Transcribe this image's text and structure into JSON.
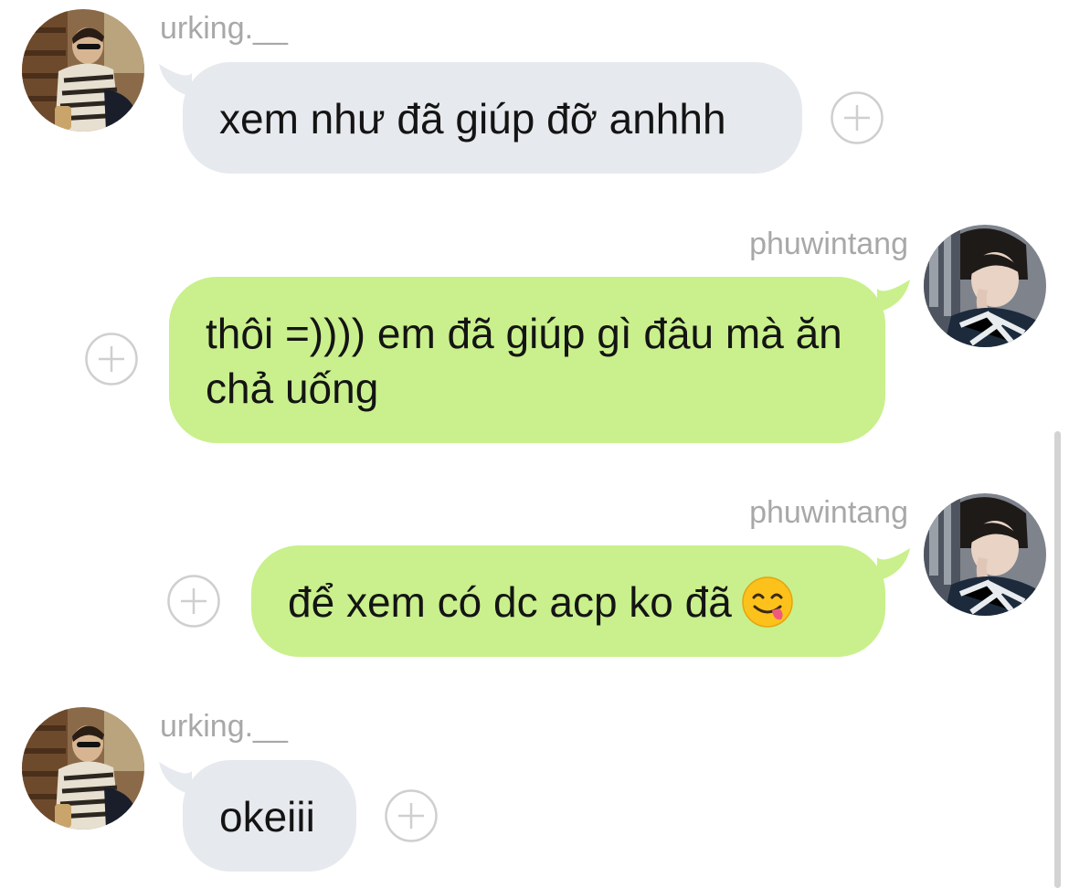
{
  "messages": [
    {
      "sender": "urking.__",
      "direction": "incoming",
      "text": "xem như đã giúp đỡ anhhh"
    },
    {
      "sender": "phuwintang",
      "direction": "outgoing",
      "text": "thôi =)))) em đã giúp gì đâu mà ăn chả uống"
    },
    {
      "sender": "phuwintang",
      "direction": "outgoing",
      "text": "để xem có dc acp ko đã",
      "emoji": "face-savoring-food"
    },
    {
      "sender": "urking.__",
      "direction": "incoming",
      "text": "okeiii"
    }
  ],
  "colors": {
    "incoming_bubble": "#e6e9ed",
    "outgoing_bubble": "#c9f08c",
    "sender_text": "#a8a8a8",
    "message_text": "#141414"
  },
  "icons": {
    "react": "add-reaction-icon"
  }
}
